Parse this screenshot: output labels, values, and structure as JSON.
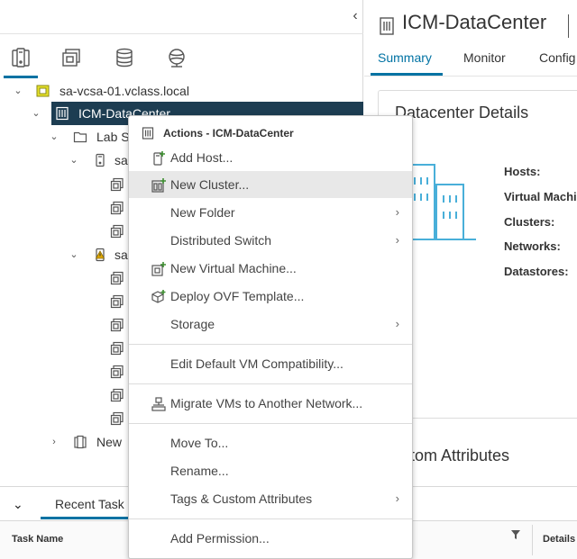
{
  "navigator": {
    "collapse_glyph": "‹",
    "tabs": [
      {
        "name": "hosts-and-clusters",
        "icon": "hosts-clusters-icon"
      },
      {
        "name": "vms-and-templates",
        "icon": "vms-templates-icon"
      },
      {
        "name": "storage",
        "icon": "database-icon"
      },
      {
        "name": "networking",
        "icon": "network-icon"
      }
    ],
    "tree": {
      "vcenter": "sa-vcsa-01.vclass.local",
      "datacenter": "ICM-DataCenter",
      "folder": "Lab S",
      "host1": "sa",
      "host2": "sa",
      "new_item": "New"
    }
  },
  "object": {
    "title": "ICM-DataCenter",
    "tabs": [
      "Summary",
      "Monitor",
      "Config"
    ]
  },
  "summary": {
    "details_title": "Datacenter Details",
    "details": [
      "Hosts:",
      "Virtual Machi",
      "Clusters:",
      "Networks:",
      "Datastores:"
    ],
    "custom_attributes_title": "ustom Attributes"
  },
  "tasks": {
    "tab_label": "Recent Task",
    "columns": {
      "task_name": "Task Name",
      "details": "Details"
    }
  },
  "context_menu": {
    "header": "Actions - ICM-DataCenter",
    "items": {
      "add_host": "Add Host...",
      "new_cluster": "New Cluster...",
      "new_folder": "New Folder",
      "distributed_switch": "Distributed Switch",
      "new_vm": "New Virtual Machine...",
      "deploy_ovf": "Deploy OVF Template...",
      "storage": "Storage",
      "edit_vm_compat": "Edit Default VM Compatibility...",
      "migrate_vms": "Migrate VMs to Another Network...",
      "move_to": "Move To...",
      "rename": "Rename...",
      "tags": "Tags & Custom Attributes",
      "add_permission": "Add Permission..."
    },
    "submenu_glyph": "›"
  },
  "colors": {
    "accent": "#0072a3",
    "selection": "#1d3d52",
    "hover": "#e8e8e8",
    "add_green": "#3c8d2f",
    "warning": "#e0a800",
    "illustration_blue": "#49afd9"
  }
}
